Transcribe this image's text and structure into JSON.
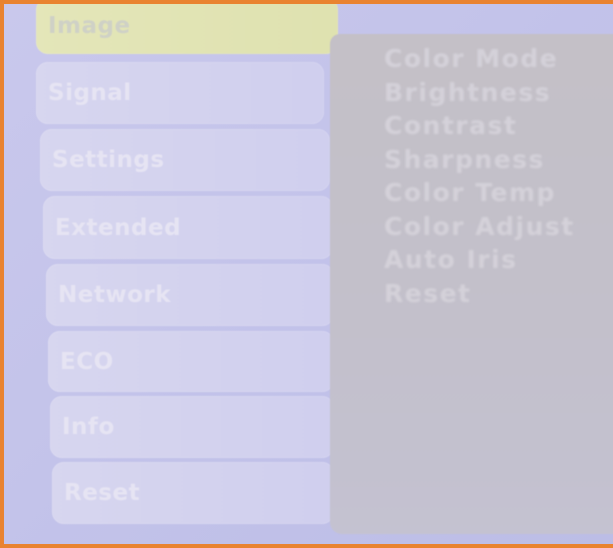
{
  "menu": {
    "items": [
      {
        "label": "Image",
        "selected": true
      },
      {
        "label": "Signal",
        "selected": false
      },
      {
        "label": "Settings",
        "selected": false
      },
      {
        "label": "Extended",
        "selected": false
      },
      {
        "label": "Network",
        "selected": false
      },
      {
        "label": "ECO",
        "selected": false
      },
      {
        "label": "Info",
        "selected": false
      },
      {
        "label": "Reset",
        "selected": false
      }
    ]
  },
  "image_panel": {
    "items": [
      "Color Mode",
      "Brightness",
      "Contrast",
      "Sharpness",
      "Color Temp",
      "Color Adjust",
      "Auto Iris",
      "Reset"
    ]
  },
  "colors": {
    "frame_border": "#e98330",
    "background": "#c5c5ea",
    "selected_tab": "#e2e4b5",
    "tab": "#d4d3ef",
    "content_panel": "#c3c0ca"
  }
}
